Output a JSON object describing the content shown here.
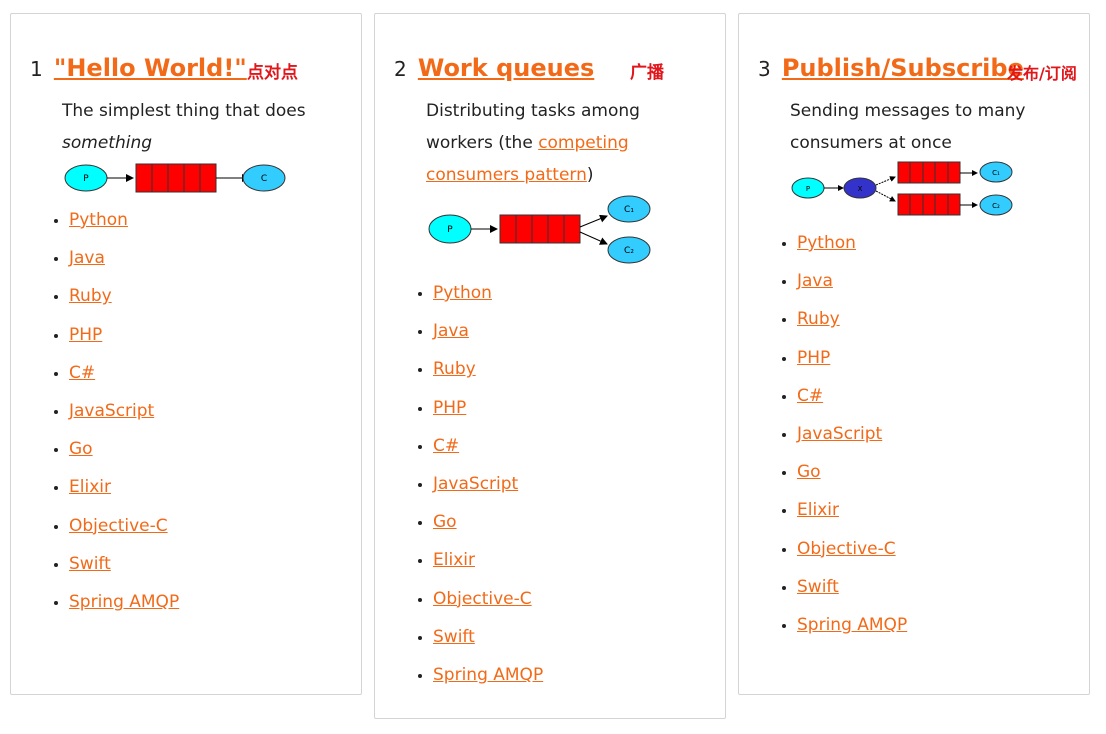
{
  "cards": [
    {
      "number": "1",
      "title": "\"Hello World!\"",
      "note": "点对点",
      "desc_line1": "The simplest thing that does",
      "desc_em": "something",
      "languages": [
        "Python",
        "Java",
        "Ruby",
        "PHP",
        "C#",
        "JavaScript",
        "Go",
        "Elixir",
        "Objective-C",
        "Swift",
        "Spring AMQP"
      ]
    },
    {
      "number": "2",
      "title": "Work queues",
      "note": "广播",
      "desc_line1": "Distributing tasks among",
      "desc_line2_pre": "workers (the ",
      "desc_link1": "competing",
      "desc_link2": "consumers pattern",
      "desc_line3_post": ")",
      "languages": [
        "Python",
        "Java",
        "Ruby",
        "PHP",
        "C#",
        "JavaScript",
        "Go",
        "Elixir",
        "Objective-C",
        "Swift",
        "Spring AMQP"
      ]
    },
    {
      "number": "3",
      "title": "Publish/Subscribe",
      "note": "发布/订阅",
      "desc_line1": "Sending messages to many",
      "desc_line2": "consumers at once",
      "languages": [
        "Python",
        "Java",
        "Ruby",
        "PHP",
        "C#",
        "JavaScript",
        "Go",
        "Elixir",
        "Objective-C",
        "Swift",
        "Spring AMQP"
      ]
    }
  ],
  "diagram_labels": {
    "producer": "P",
    "consumer": "C",
    "consumer1": "C₁",
    "consumer2": "C₂",
    "exchange": "X"
  },
  "colors": {
    "link": "#f26a18",
    "note": "#e0161b",
    "queue": "#ff0000",
    "producer": "#00ffff",
    "consumer": "#33ccff",
    "exchange": "#3333cc"
  }
}
